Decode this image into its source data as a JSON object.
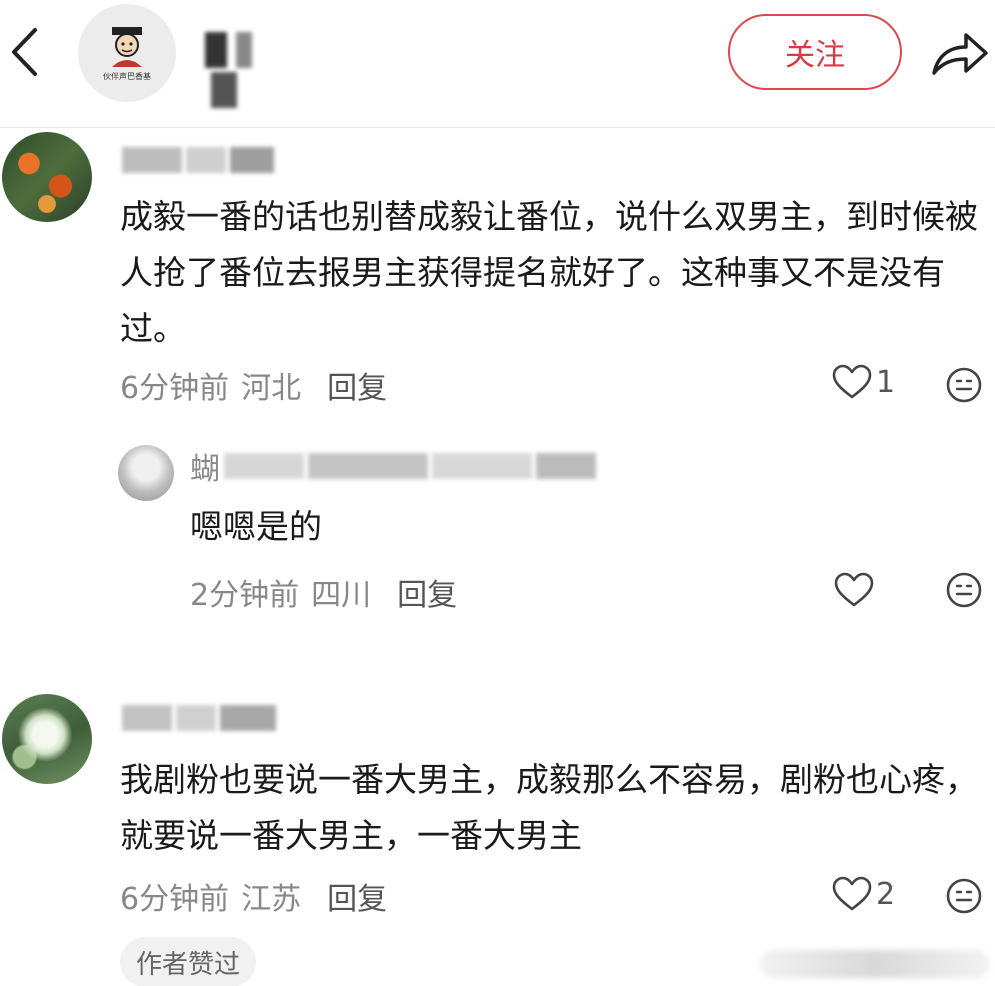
{
  "header": {
    "follow_label": "关注",
    "avatar_icon": "account-logo-icon",
    "avatar_caption": "伙伴声巴香基"
  },
  "comments": [
    {
      "text": "成毅一番的话也别替成毅让番位，说什么双男主，到时候被人抢了番位去报男主获得提名就好了。这种事又不是没有过。",
      "time": "6分钟前",
      "location": "河北",
      "reply_label": "回复",
      "like_count": "1"
    },
    {
      "username_prefix": "蝴",
      "text": "嗯嗯是的",
      "time": "2分钟前",
      "location": "四川",
      "reply_label": "回复",
      "like_count": ""
    },
    {
      "text": "我剧粉也要说一番大男主，成毅那么不容易，剧粉也心疼，就要说一番大男主，一番大男主",
      "time": "6分钟前",
      "location": "江苏",
      "reply_label": "回复",
      "like_count": "2",
      "badge": "作者赞过"
    }
  ],
  "colors": {
    "accent": "#d93a44",
    "text": "#1a1a1a",
    "meta": "#888888"
  }
}
